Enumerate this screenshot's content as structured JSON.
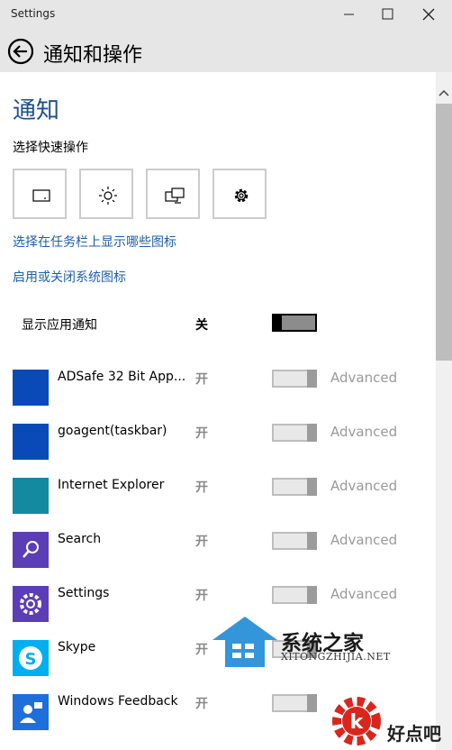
{
  "window": {
    "title": "Settings"
  },
  "header": {
    "title": "通知和操作"
  },
  "notifications": {
    "section_title": "通知",
    "quick_actions_label": "选择快速操作",
    "quick_actions": [
      {
        "icon": "tablet-mode-icon"
      },
      {
        "icon": "brightness-icon"
      },
      {
        "icon": "project-icon"
      },
      {
        "icon": "settings-gear-icon"
      }
    ],
    "taskbar_link": "选择在任务栏上显示哪些图标",
    "system_icons_link": "启用或关闭系统图标",
    "show_app_notifications_label": "显示应用通知",
    "show_app_notifications_state": "关"
  },
  "apps": [
    {
      "name": "ADSafe 32 Bit App...",
      "state": "开",
      "advanced": "Advanced",
      "color": "#0a4ab8"
    },
    {
      "name": "goagent(taskbar)",
      "state": "开",
      "advanced": "Advanced",
      "color": "#0a4ab8"
    },
    {
      "name": "Internet Explorer",
      "state": "开",
      "advanced": "Advanced",
      "color": "#138aa0"
    },
    {
      "name": "Search",
      "state": "开",
      "advanced": "Advanced",
      "color": "#5b3db5"
    },
    {
      "name": "Settings",
      "state": "开",
      "advanced": "Advanced",
      "color": "#5b3db5"
    },
    {
      "name": "Skype",
      "state": "开",
      "advanced": "",
      "color": "#00aff0"
    },
    {
      "name": "Windows Feedback",
      "state": "开",
      "advanced": "",
      "color": "#1e6fd9"
    }
  ],
  "watermark": {
    "site1": "系统之家",
    "site1_sub": "XITONGZHIJIA.NET",
    "site2": "好点吧"
  },
  "colors": {
    "accent": "#1f4f8b",
    "link": "#1f5ea8",
    "chrome": "#e6e6e6"
  }
}
